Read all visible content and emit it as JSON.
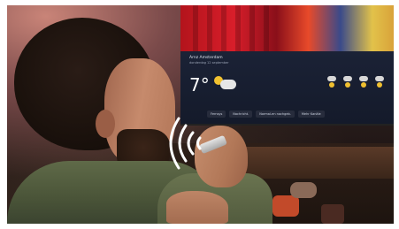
{
  "tv_screen": {
    "location": "Arnz Amsterdam",
    "date": "donderdag 12 september",
    "temperature": "7°",
    "bar_items": [
      "Fernsys",
      "Nachricht.",
      "Normal-en nachgeb.",
      "Mehr Kanäle"
    ]
  },
  "colors": {
    "tv_top_accent": "#d81e2a",
    "shirt": "#5f6a48",
    "sound_waves": "#ffffff"
  },
  "icons": [
    "sound-waves-icon",
    "weather-cloud-icon",
    "weather-sun-icon"
  ]
}
